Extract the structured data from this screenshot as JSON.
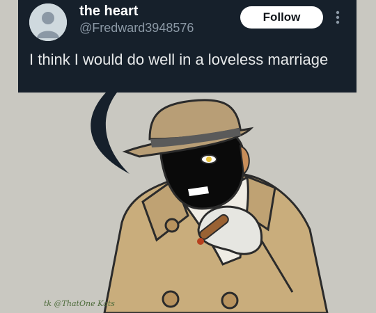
{
  "tweet": {
    "display_name": "the heart",
    "handle": "@Fredward3948576",
    "follow_label": "Follow",
    "text": "I think I would do well in a loveless marriage",
    "avatar_icon": "default-profile-icon",
    "more_icon": "more-vertical-icon"
  },
  "illustration": {
    "description_icon": "trenchcoat-character-with-cigar",
    "watermark": "tk @ThatOne Kats"
  },
  "colors": {
    "card_bg": "#16202b",
    "background": "#c9c8c1",
    "coat": "#c9ad7c",
    "hat": "#b89e76"
  }
}
